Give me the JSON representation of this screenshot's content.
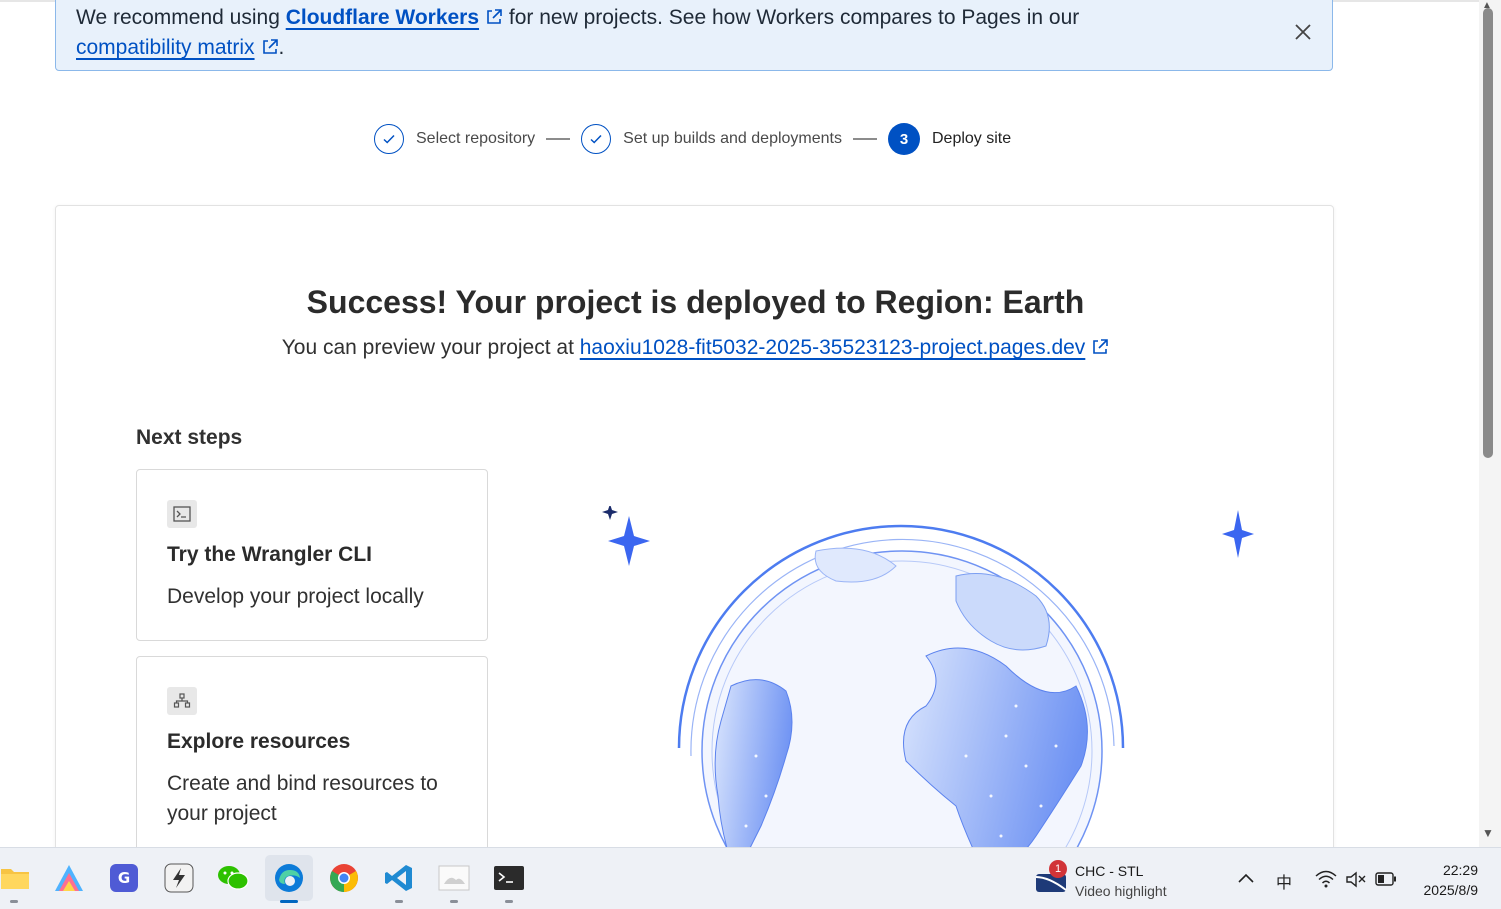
{
  "banner": {
    "text_1": "We recommend using ",
    "link_workers": "Cloudflare Workers",
    "text_2": " for new projects. See how Workers compares to Pages in our",
    "link_matrix": "compatibility matrix",
    "text_3": "."
  },
  "stepper": {
    "steps": [
      {
        "label": "Select repository",
        "state": "done"
      },
      {
        "label": "Set up builds and deployments",
        "state": "done"
      },
      {
        "label": "Deploy site",
        "state": "active",
        "number": "3"
      }
    ]
  },
  "main": {
    "title": "Success! Your project is deployed to Region: Earth",
    "subtitle_prefix": "You can preview your project at ",
    "preview_link": "haoxiu1028-fit5032-2025-35523123-project.pages.dev",
    "next_steps_heading": "Next steps",
    "tiles": [
      {
        "title": "Try the Wrangler CLI",
        "description": "Develop your project locally",
        "icon": "terminal-icon"
      },
      {
        "title": "Explore resources",
        "description": "Create and bind resources to your project",
        "icon": "sitemap-icon"
      }
    ]
  },
  "taskbar": {
    "apps": [
      "file-explorer",
      "arc-app",
      "gbox-app",
      "lightning-app",
      "wechat-app",
      "edge-browser",
      "chrome-browser",
      "vscode-app",
      "photos-app",
      "terminal-app"
    ],
    "notification": {
      "badge": "1",
      "title": "CHC - STL",
      "subtitle": "Video highlight"
    },
    "ime": "中",
    "time": "22:29",
    "date": "2025/8/9"
  },
  "colors": {
    "accent": "#0051c3",
    "banner_bg": "#e8f1fb",
    "globe": "#4d7cf0"
  }
}
